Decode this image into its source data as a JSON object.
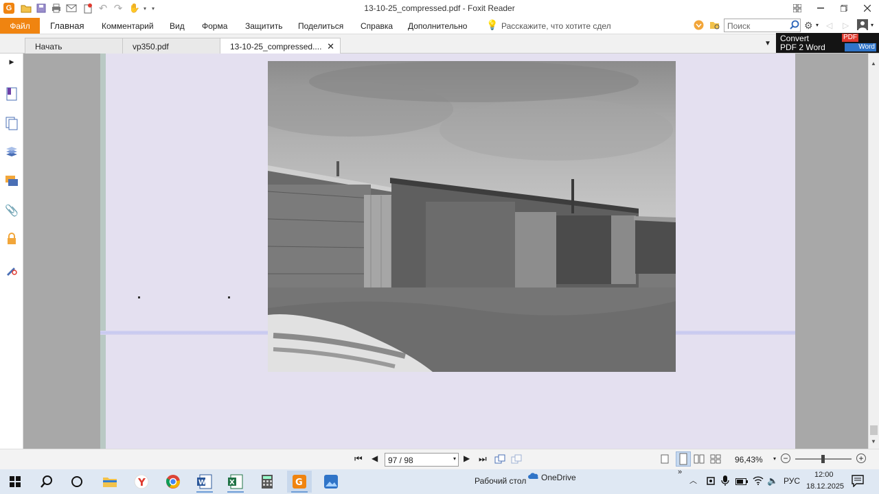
{
  "app": {
    "window_title": "13-10-25_compressed.pdf - Foxit Reader"
  },
  "ribbon": {
    "file_label": "Файл",
    "tabs": [
      "Главная",
      "Комментарий",
      "Вид",
      "Форма",
      "Защитить",
      "Поделиться",
      "Справка",
      "Дополнительно"
    ],
    "tell_me": "Расскажите, что хотите сдел",
    "search_placeholder": "Поиск"
  },
  "doc_tabs": [
    {
      "label": "Начать"
    },
    {
      "label": "vp350.pdf"
    },
    {
      "label": "13-10-25_compressed...."
    }
  ],
  "convert_ad": {
    "line1": "Convert",
    "line2": "PDF 2 Word",
    "pdf_badge": "PDF",
    "word_badge": "Word"
  },
  "left_panel": {
    "icons": [
      "bookmark-icon",
      "pages-icon",
      "layers-icon",
      "comments-icon",
      "attachments-icon",
      "security-icon",
      "signature-icon"
    ]
  },
  "status": {
    "page_field": "97 / 98",
    "zoom": "96,43%"
  },
  "taskbar": {
    "desktop_label": "Рабочий стол",
    "onedrive_label": "OneDrive",
    "chevron": "»",
    "language": "РУС",
    "time": "12:00",
    "date": "18.12.2025"
  },
  "colors": {
    "accent": "#f08410",
    "page_tint": "#e4e0f0",
    "taskbar": "#dfe8f3"
  }
}
